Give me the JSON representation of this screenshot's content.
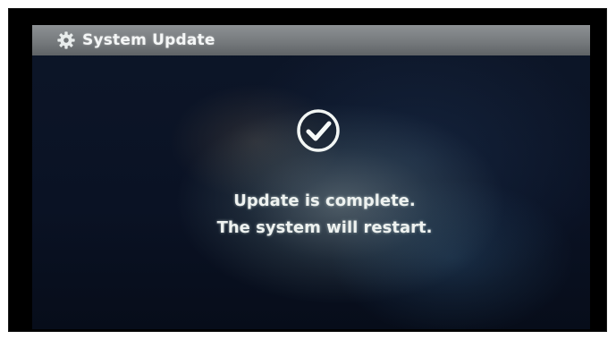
{
  "window": {
    "title": "System Update"
  },
  "icons": {
    "title_icon": "gear-icon",
    "status_icon": "checkmark-circle-icon"
  },
  "message": {
    "line1": "Update is complete.",
    "line2": "The system will restart."
  },
  "colors": {
    "title_bar": "#7a7e81",
    "screen_background": "#0b1426",
    "text": "#eef2f0"
  }
}
